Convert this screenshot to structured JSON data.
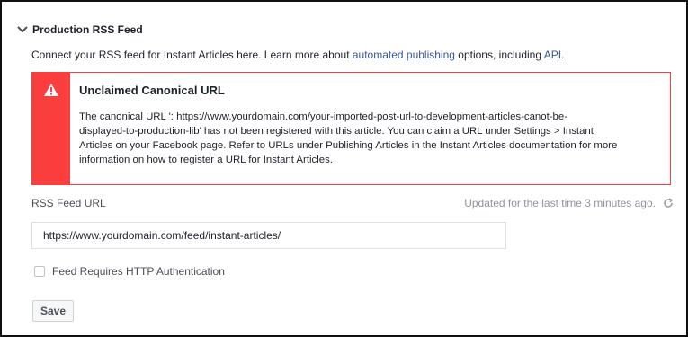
{
  "section": {
    "title": "Production RSS Feed",
    "icon": "chevron-down-icon"
  },
  "intro": {
    "prefix": "Connect your RSS feed for Instant Articles here. Learn more about ",
    "link1": "automated publishing",
    "middle": " options, including ",
    "link2": "API",
    "suffix": "."
  },
  "alert": {
    "icon": "warning-icon",
    "title": "Unclaimed Canonical URL",
    "line1": "The canonical URL ': https://www.yourdomain.com/your-imported-post-url-to-development-articles-canot-be-",
    "line2": "displayed-to-production-lib' has not been registered with this article. You can claim a URL under Settings > Instant",
    "line3": "Articles on your Facebook page. Refer to URLs under Publishing Articles in the Instant Articles documentation for more",
    "line4": "information on how to register a URL for Instant Articles.",
    "color": "#fa3e3e"
  },
  "rss": {
    "label": "RSS Feed URL",
    "updated": "Updated for the last time 3 minutes ago.",
    "refresh_icon": "refresh-icon",
    "url_value": "https://www.yourdomain.com/feed/instant-articles/"
  },
  "auth": {
    "label": "Feed Requires HTTP Authentication",
    "checked": false
  },
  "actions": {
    "save_label": "Save"
  },
  "colors": {
    "link": "#365899",
    "muted": "#90949c"
  }
}
